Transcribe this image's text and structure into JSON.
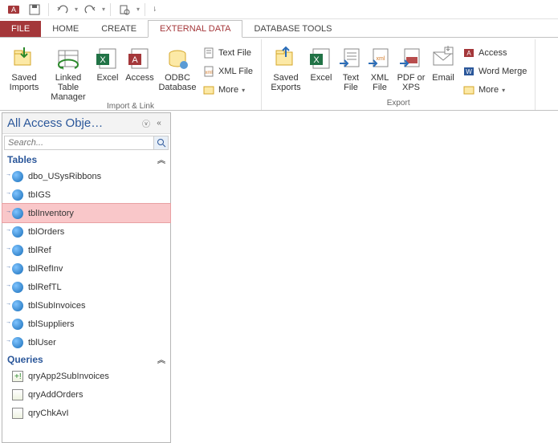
{
  "qat": {
    "app": "Access"
  },
  "tabs": {
    "file": "FILE",
    "home": "HOME",
    "create": "CREATE",
    "external": "EXTERNAL DATA",
    "dbtools": "DATABASE TOOLS"
  },
  "ribbon": {
    "importLink": {
      "label": "Import & Link",
      "savedImports": "Saved Imports",
      "linkedTableMgr": "Linked Table Manager",
      "excel": "Excel",
      "access": "Access",
      "odbc": "ODBC Database",
      "textFile": "Text File",
      "xmlFile": "XML File",
      "more": "More"
    },
    "export": {
      "label": "Export",
      "savedExports": "Saved Exports",
      "excel": "Excel",
      "textFile": "Text File",
      "xmlFile": "XML File",
      "pdfXps": "PDF or XPS",
      "email": "Email",
      "access": "Access",
      "wordMerge": "Word Merge",
      "more": "More"
    }
  },
  "nav": {
    "title": "All Access Obje…",
    "searchPlaceholder": "Search...",
    "tablesHeader": "Tables",
    "queriesHeader": "Queries",
    "tables": {
      "0": "dbo_USysRibbons",
      "1": "tbIGS",
      "2": "tblInventory",
      "3": "tblOrders",
      "4": "tblRef",
      "5": "tblRefInv",
      "6": "tblRefTL",
      "7": "tblSubInvoices",
      "8": "tblSuppliers",
      "9": "tblUser"
    },
    "queries": {
      "0": "qryApp2SubInvoices",
      "1": "qryAddOrders",
      "2": "qryChkAvI"
    }
  }
}
